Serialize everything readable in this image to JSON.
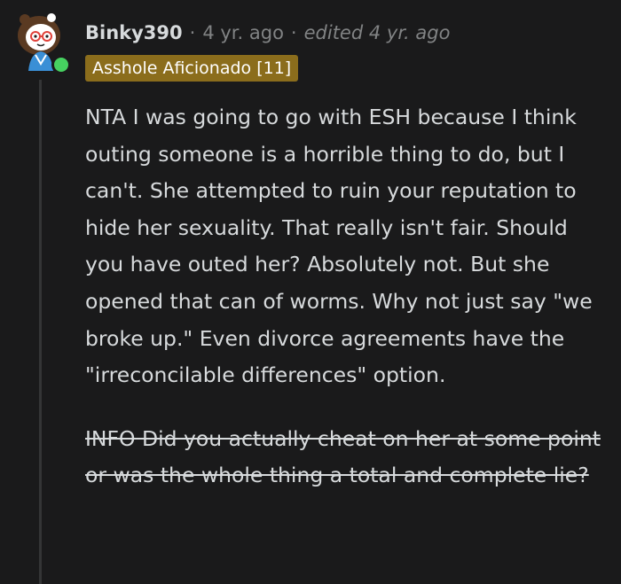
{
  "comment": {
    "author": "Binky390",
    "time": "4 yr. ago",
    "separator": "·",
    "edited": "edited 4 yr. ago",
    "flair": "Asshole Aficionado [11]",
    "paragraphs": [
      "NTA I was going to go with ESH because I think outing someone is a horrible thing to do, but I can't. She attempted to ruin your reputation to hide her sexuality. That really isn't fair. Should you have outed her? Absolutely not. But she opened that can of worms. Why not just say \"we broke up.\" Even divorce agreements have the \"irreconcilable differences\" option."
    ],
    "struck_paragraph": "INFO Did you actually cheat on her at some point or was the whole thing a total and complete lie?"
  },
  "colors": {
    "background": "#1a1a1b",
    "text": "#d7dadc",
    "meta": "#818384",
    "flair_bg": "#8b6d1c",
    "online": "#46d160",
    "thread_line": "#343536"
  },
  "icons": {
    "avatar": "user-avatar-icon",
    "online": "online-status-icon"
  }
}
